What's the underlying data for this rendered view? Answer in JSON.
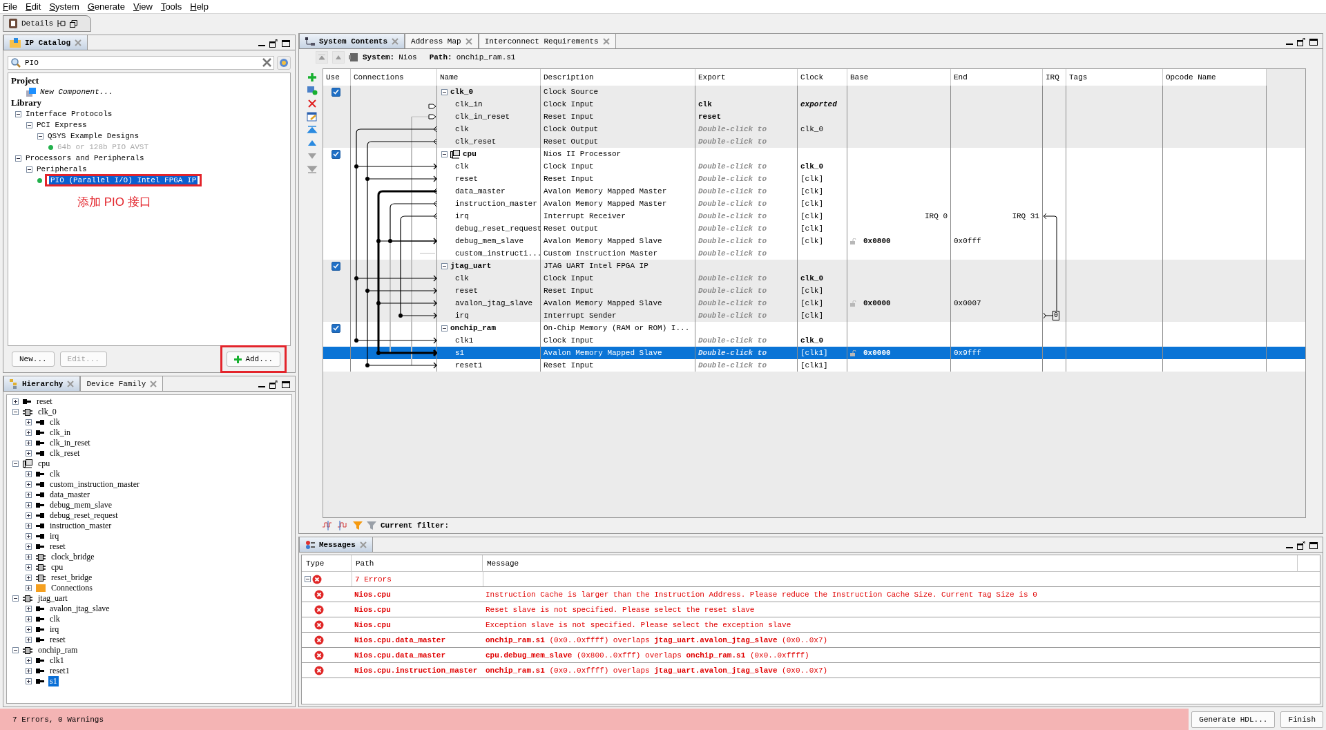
{
  "menu": [
    {
      "label": "File"
    },
    {
      "label": "Edit"
    },
    {
      "label": "System"
    },
    {
      "label": "Generate"
    },
    {
      "label": "View"
    },
    {
      "label": "Tools"
    },
    {
      "label": "Help"
    }
  ],
  "details_tab": {
    "label": "Details"
  },
  "catalog": {
    "tabs": [
      {
        "label": "IP Catalog",
        "selected": true
      }
    ],
    "search": {
      "value": "PIO"
    },
    "sections": [
      {
        "title": "Project",
        "items": [
          {
            "label": "New Component...",
            "kind": "new",
            "selected": false,
            "disabled": false
          }
        ]
      },
      {
        "title": "Library",
        "items": [
          {
            "label": "Interface Protocols",
            "kind": "folder",
            "expanded": true,
            "selected": false,
            "disabled": false,
            "children": [
              {
                "label": "PCI Express",
                "kind": "folder",
                "expanded": true,
                "selected": false,
                "disabled": false,
                "children": [
                  {
                    "label": "QSYS Example Designs",
                    "kind": "folder",
                    "expanded": true,
                    "selected": false,
                    "disabled": false,
                    "children": [
                      {
                        "label": "64b or 128b PIO AVST",
                        "kind": "ip",
                        "selected": false,
                        "disabled": true,
                        "highlighted": false
                      }
                    ]
                  }
                ]
              }
            ]
          },
          {
            "label": "Processors and Peripherals",
            "kind": "folder",
            "expanded": true,
            "selected": false,
            "disabled": false,
            "children": [
              {
                "label": "Peripherals",
                "kind": "folder",
                "expanded": true,
                "selected": false,
                "disabled": false,
                "children": [
                  {
                    "label": "PIO (Parallel I/O) Intel FPGA IP",
                    "kind": "ip",
                    "selected": true,
                    "disabled": false,
                    "highlighted": true
                  }
                ]
              }
            ]
          }
        ]
      }
    ],
    "annotation": "添加 PIO 接口",
    "buttons": [
      {
        "label": "New...",
        "kind": "plain",
        "disabled": false,
        "highlighted": false
      },
      {
        "label": "Edit...",
        "kind": "plain",
        "disabled": true,
        "highlighted": false
      },
      {
        "label": "Add...",
        "kind": "add",
        "disabled": false,
        "highlighted": true
      }
    ]
  },
  "hierarchy": {
    "tabs": [
      {
        "label": "Hierarchy",
        "selected": true
      },
      {
        "label": "Device Family",
        "selected": false
      }
    ],
    "nodes": [
      {
        "label": "reset",
        "kind": "in",
        "expanded": false,
        "selected": false
      },
      {
        "label": "clk_0",
        "kind": "component",
        "expanded": true,
        "selected": false,
        "children": [
          {
            "label": "clk",
            "kind": "out",
            "expanded": false,
            "selected": false
          },
          {
            "label": "clk_in",
            "kind": "in",
            "expanded": false,
            "selected": false
          },
          {
            "label": "clk_in_reset",
            "kind": "in",
            "expanded": false,
            "selected": false
          },
          {
            "label": "clk_reset",
            "kind": "out",
            "expanded": false,
            "selected": false
          }
        ]
      },
      {
        "label": "cpu",
        "kind": "processor",
        "expanded": true,
        "selected": false,
        "children": [
          {
            "label": "clk",
            "kind": "in",
            "expanded": false,
            "selected": false
          },
          {
            "label": "custom_instruction_master",
            "kind": "out",
            "expanded": false,
            "selected": false
          },
          {
            "label": "data_master",
            "kind": "out",
            "expanded": false,
            "selected": false
          },
          {
            "label": "debug_mem_slave",
            "kind": "in",
            "expanded": false,
            "selected": false
          },
          {
            "label": "debug_reset_request",
            "kind": "out",
            "expanded": false,
            "selected": false
          },
          {
            "label": "instruction_master",
            "kind": "out",
            "expanded": false,
            "selected": false
          },
          {
            "label": "irq",
            "kind": "out",
            "expanded": false,
            "selected": false
          },
          {
            "label": "reset",
            "kind": "in",
            "expanded": false,
            "selected": false
          },
          {
            "label": "clock_bridge",
            "kind": "component",
            "expanded": false,
            "selected": false
          },
          {
            "label": "cpu",
            "kind": "component",
            "expanded": false,
            "selected": false
          },
          {
            "label": "reset_bridge",
            "kind": "component",
            "expanded": false,
            "selected": false
          },
          {
            "label": "Connections",
            "kind": "folder",
            "expanded": false,
            "selected": false
          }
        ]
      },
      {
        "label": "jtag_uart",
        "kind": "component",
        "expanded": true,
        "selected": false,
        "children": [
          {
            "label": "avalon_jtag_slave",
            "kind": "in",
            "expanded": false,
            "selected": false
          },
          {
            "label": "clk",
            "kind": "in",
            "expanded": false,
            "selected": false
          },
          {
            "label": "irq",
            "kind": "in",
            "expanded": false,
            "selected": false
          },
          {
            "label": "reset",
            "kind": "in",
            "expanded": false,
            "selected": false
          }
        ]
      },
      {
        "label": "onchip_ram",
        "kind": "component",
        "expanded": true,
        "selected": false,
        "children": [
          {
            "label": "clk1",
            "kind": "in",
            "expanded": false,
            "selected": false
          },
          {
            "label": "reset1",
            "kind": "in",
            "expanded": false,
            "selected": false
          },
          {
            "label": "s1",
            "kind": "in",
            "expanded": false,
            "selected": true
          }
        ]
      }
    ]
  },
  "system": {
    "tabs": [
      {
        "label": "System Contents",
        "selected": true
      },
      {
        "label": "Address Map",
        "selected": false
      },
      {
        "label": "Interconnect Requirements",
        "selected": false
      }
    ],
    "path_bar": {
      "system_label": "System:",
      "system": "Nios",
      "path_label": "Path:",
      "path": "onchip_ram.s1"
    },
    "columns": [
      "Use",
      "Connections",
      "Name",
      "Description",
      "Export",
      "Clock",
      "Base",
      "End",
      "IRQ",
      "Tags",
      "Opcode Name"
    ],
    "components": [
      {
        "name": "clk_0",
        "description": "Clock Source",
        "kind": "plain",
        "use": true,
        "expanded": true,
        "selected": false,
        "ports": [
          {
            "name": "clk_in",
            "description": "Clock Input",
            "export": {
              "text": "clk",
              "kind": "name"
            },
            "clock": {
              "text": "exported",
              "kind": "exported"
            },
            "selected": false
          },
          {
            "name": "clk_in_reset",
            "description": "Reset Input",
            "export": {
              "text": "reset",
              "kind": "name"
            },
            "selected": false
          },
          {
            "name": "clk",
            "description": "Clock Output",
            "export": {
              "text": "Double-click to",
              "kind": "hint"
            },
            "clock": {
              "text": "clk_0",
              "kind": "plain"
            },
            "selected": false
          },
          {
            "name": "clk_reset",
            "description": "Reset Output",
            "export": {
              "text": "Double-click to",
              "kind": "hint"
            },
            "selected": false
          }
        ]
      },
      {
        "name": "cpu",
        "description": "Nios II Processor",
        "kind": "processor",
        "use": true,
        "expanded": true,
        "selected": false,
        "ports": [
          {
            "name": "clk",
            "description": "Clock Input",
            "export": {
              "text": "Double-click to",
              "kind": "hint"
            },
            "clock": {
              "text": "clk_0",
              "kind": "bold"
            },
            "selected": false
          },
          {
            "name": "reset",
            "description": "Reset Input",
            "export": {
              "text": "Double-click to",
              "kind": "hint"
            },
            "clock": {
              "text": "[clk]",
              "kind": "plain"
            },
            "selected": false
          },
          {
            "name": "data_master",
            "description": "Avalon Memory Mapped Master",
            "export": {
              "text": "Double-click to",
              "kind": "hint"
            },
            "clock": {
              "text": "[clk]",
              "kind": "plain"
            },
            "selected": false
          },
          {
            "name": "instruction_master",
            "description": "Avalon Memory Mapped Master",
            "export": {
              "text": "Double-click to",
              "kind": "hint"
            },
            "clock": {
              "text": "[clk]",
              "kind": "plain"
            },
            "selected": false
          },
          {
            "name": "irq",
            "description": "Interrupt Receiver",
            "export": {
              "text": "Double-click to",
              "kind": "hint"
            },
            "clock": {
              "text": "[clk]",
              "kind": "plain"
            },
            "irq_range": [
              "IRQ 0",
              "IRQ 31"
            ],
            "selected": false
          },
          {
            "name": "debug_reset_request",
            "description": "Reset Output",
            "export": {
              "text": "Double-click to",
              "kind": "hint"
            },
            "clock": {
              "text": "[clk]",
              "kind": "plain"
            },
            "selected": false
          },
          {
            "name": "debug_mem_slave",
            "description": "Avalon Memory Mapped Slave",
            "export": {
              "text": "Double-click to",
              "kind": "hint"
            },
            "clock": {
              "text": "[clk]",
              "kind": "plain"
            },
            "base": "0x0800",
            "end": "0x0fff",
            "selected": false
          },
          {
            "name": "custom_instructi...",
            "description": "Custom Instruction Master",
            "export": {
              "text": "Double-click to",
              "kind": "hint"
            },
            "selected": false
          }
        ]
      },
      {
        "name": "jtag_uart",
        "description": "JTAG UART Intel FPGA IP",
        "kind": "plain",
        "use": true,
        "expanded": true,
        "selected": false,
        "ports": [
          {
            "name": "clk",
            "description": "Clock Input",
            "export": {
              "text": "Double-click to",
              "kind": "hint"
            },
            "clock": {
              "text": "clk_0",
              "kind": "bold"
            },
            "selected": false
          },
          {
            "name": "reset",
            "description": "Reset Input",
            "export": {
              "text": "Double-click to",
              "kind": "hint"
            },
            "clock": {
              "text": "[clk]",
              "kind": "plain"
            },
            "selected": false
          },
          {
            "name": "avalon_jtag_slave",
            "description": "Avalon Memory Mapped Slave",
            "export": {
              "text": "Double-click to",
              "kind": "hint"
            },
            "clock": {
              "text": "[clk]",
              "kind": "plain"
            },
            "base": "0x0000",
            "end": "0x0007",
            "selected": false
          },
          {
            "name": "irq",
            "description": "Interrupt Sender",
            "export": {
              "text": "Double-click to",
              "kind": "hint"
            },
            "clock": {
              "text": "[clk]",
              "kind": "plain"
            },
            "irq_number": "0",
            "selected": false
          }
        ]
      },
      {
        "name": "onchip_ram",
        "description": "On-Chip Memory (RAM or ROM) I...",
        "kind": "plain",
        "use": true,
        "expanded": true,
        "selected": false,
        "ports": [
          {
            "name": "clk1",
            "description": "Clock Input",
            "export": {
              "text": "Double-click to",
              "kind": "hint"
            },
            "clock": {
              "text": "clk_0",
              "kind": "bold"
            },
            "selected": false
          },
          {
            "name": "s1",
            "description": "Avalon Memory Mapped Slave",
            "export": {
              "text": "Double-click to",
              "kind": "hint"
            },
            "clock": {
              "text": "[clk1]",
              "kind": "plain"
            },
            "base": "0x0000",
            "end": "0x9fff",
            "selected": true
          },
          {
            "name": "reset1",
            "description": "Reset Input",
            "export": {
              "text": "Double-click to",
              "kind": "hint"
            },
            "clock": {
              "text": "[clk1]",
              "kind": "plain"
            },
            "selected": false
          }
        ]
      }
    ],
    "filter_label": "Current filter:"
  },
  "messages": {
    "tabs": [
      {
        "label": "Messages",
        "selected": true
      }
    ],
    "columns": [
      "Type",
      "Path",
      "Message"
    ],
    "group": {
      "label": "7 Errors",
      "expanded": true
    },
    "rows": [
      {
        "kind": "error",
        "path": "Nios.cpu",
        "message": "Instruction Cache is larger than the Instruction Address. Please reduce the Instruction Cache Size. Current Tag Size is 0"
      },
      {
        "kind": "error",
        "path": "Nios.cpu",
        "message": "Reset slave is not specified. Please select the reset slave"
      },
      {
        "kind": "error",
        "path": "Nios.cpu",
        "message": "Exception slave is not specified. Please select the exception slave"
      },
      {
        "kind": "error",
        "path": "Nios.cpu.data_master",
        "message": "**onchip_ram.s1** (0x0..0xffff) overlaps **jtag_uart.avalon_jtag_slave** (0x0..0x7)"
      },
      {
        "kind": "error",
        "path": "Nios.cpu.data_master",
        "message": "**cpu.debug_mem_slave** (0x800..0xfff) overlaps **onchip_ram.s1** (0x0..0xffff)"
      },
      {
        "kind": "error",
        "path": "Nios.cpu.instruction_master",
        "message": "**onchip_ram.s1** (0x0..0xffff) overlaps **jtag_uart.avalon_jtag_slave** (0x0..0x7)"
      }
    ]
  },
  "status_bar": {
    "text": "7 Errors, 0 Warnings",
    "buttons": [
      {
        "label": "Generate HDL..."
      },
      {
        "label": "Finish"
      }
    ]
  }
}
